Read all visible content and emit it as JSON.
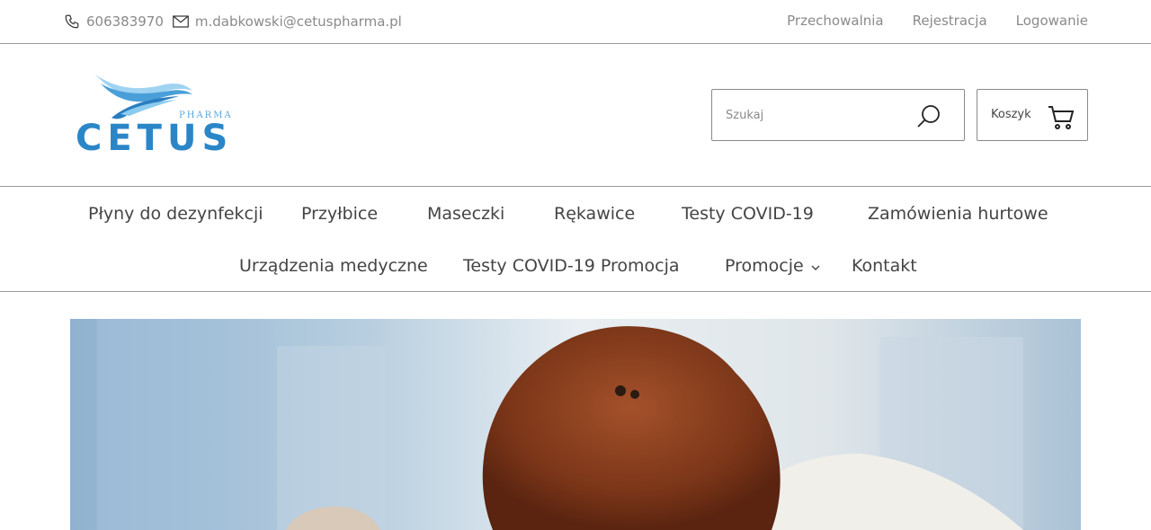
{
  "topbar": {
    "phone": "606383970",
    "email": "m.dabkowski@cetuspharma.pl",
    "links": [
      "Przechowalnia",
      "Rejestracja",
      "Logowanie"
    ]
  },
  "header": {
    "logo_text": "CETUS",
    "logo_sub": "PHARMA",
    "search_placeholder": "Szukaj",
    "cart_label": "Koszyk"
  },
  "nav": {
    "items": [
      "Płyny do dezynfekcji",
      "Przyłbice",
      "Maseczki",
      "Rękawice",
      "Testy COVID-19",
      "Zamówienia hurtowe",
      "Urządzenia medyczne",
      "Testy COVID-19 Promocja",
      "Promocje",
      "Kontakt"
    ]
  },
  "colors": {
    "logo_blue_light": "#7cc2ea",
    "logo_blue_dark": "#1e6aa8",
    "border": "#9a9a9a",
    "muted_text": "#8a8a8a"
  },
  "icons": {
    "phone": "phone-icon",
    "email": "envelope-icon",
    "search": "search-icon",
    "cart": "cart-icon",
    "chevron": "chevron-down-icon"
  }
}
